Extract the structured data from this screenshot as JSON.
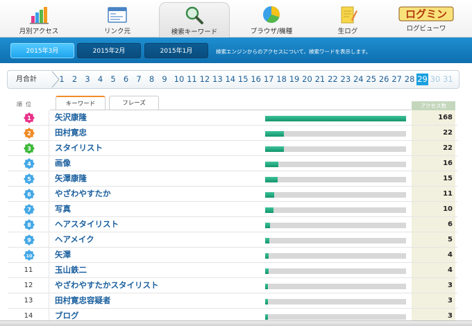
{
  "nav": {
    "items": [
      {
        "label": "月別アクセス",
        "icon": "bar-chart-icon"
      },
      {
        "label": "リンク元",
        "icon": "browser-window-icon"
      },
      {
        "label": "検索キーワード",
        "icon": "magnifier-icon",
        "active": true
      },
      {
        "label": "ブラウザ/機種",
        "icon": "pie-chart-icon"
      },
      {
        "label": "生ログ",
        "icon": "notepad-pencil-icon"
      },
      {
        "label": "ログビューワ",
        "icon": "logmi-logo-icon",
        "logo_text": "ログミン"
      }
    ]
  },
  "months": {
    "buttons": [
      "2015年3月",
      "2015年2月",
      "2015年1月"
    ],
    "active_index": 0,
    "description": "検索エンジンからのアクセスについて、検索ワードを表示します。"
  },
  "days": {
    "label": "月合計",
    "items": [
      "1",
      "2",
      "3",
      "4",
      "5",
      "6",
      "7",
      "8",
      "9",
      "10",
      "11",
      "12",
      "13",
      "14",
      "15",
      "16",
      "17",
      "18",
      "19",
      "20",
      "21",
      "22",
      "23",
      "24",
      "25",
      "26",
      "27",
      "28",
      "29",
      "30",
      "31"
    ],
    "current": "29",
    "disabled": [
      "30",
      "31"
    ]
  },
  "table": {
    "rank_header": "順位",
    "tabs": [
      "キーワード",
      "フレーズ"
    ],
    "active_tab": 0,
    "count_header": "アクセス数",
    "max_count": 168,
    "rows": [
      {
        "rank": "1",
        "keyword": "矢沢康隆",
        "count": 168
      },
      {
        "rank": "2",
        "keyword": "田村寛忠",
        "count": 22
      },
      {
        "rank": "3",
        "keyword": "スタイリスト",
        "count": 22
      },
      {
        "rank": "4",
        "keyword": "画像",
        "count": 16
      },
      {
        "rank": "5",
        "keyword": "矢澤康隆",
        "count": 15
      },
      {
        "rank": "6",
        "keyword": "やざわやすたか",
        "count": 11
      },
      {
        "rank": "7",
        "keyword": "写真",
        "count": 10
      },
      {
        "rank": "8",
        "keyword": "ヘアスタイリスト",
        "count": 6
      },
      {
        "rank": "9",
        "keyword": "ヘアメイク",
        "count": 5
      },
      {
        "rank": "10",
        "keyword": "矢澤",
        "count": 4
      },
      {
        "rank": "11",
        "keyword": "玉山鉄二",
        "count": 4
      },
      {
        "rank": "12",
        "keyword": "やざわやすたかスタイリスト",
        "count": 3
      },
      {
        "rank": "13",
        "keyword": "田村寛忠容疑者",
        "count": 3
      },
      {
        "rank": "14",
        "keyword": "ブログ",
        "count": 3
      }
    ]
  },
  "colors": {
    "badge_1": "#e8338a",
    "badge_2": "#f08a24",
    "badge_3": "#3db83a",
    "badge_other": "#43a7e6",
    "bar_fill": "#1aa57a",
    "link": "#1a5f9e",
    "month_bar": "#1580c4"
  }
}
